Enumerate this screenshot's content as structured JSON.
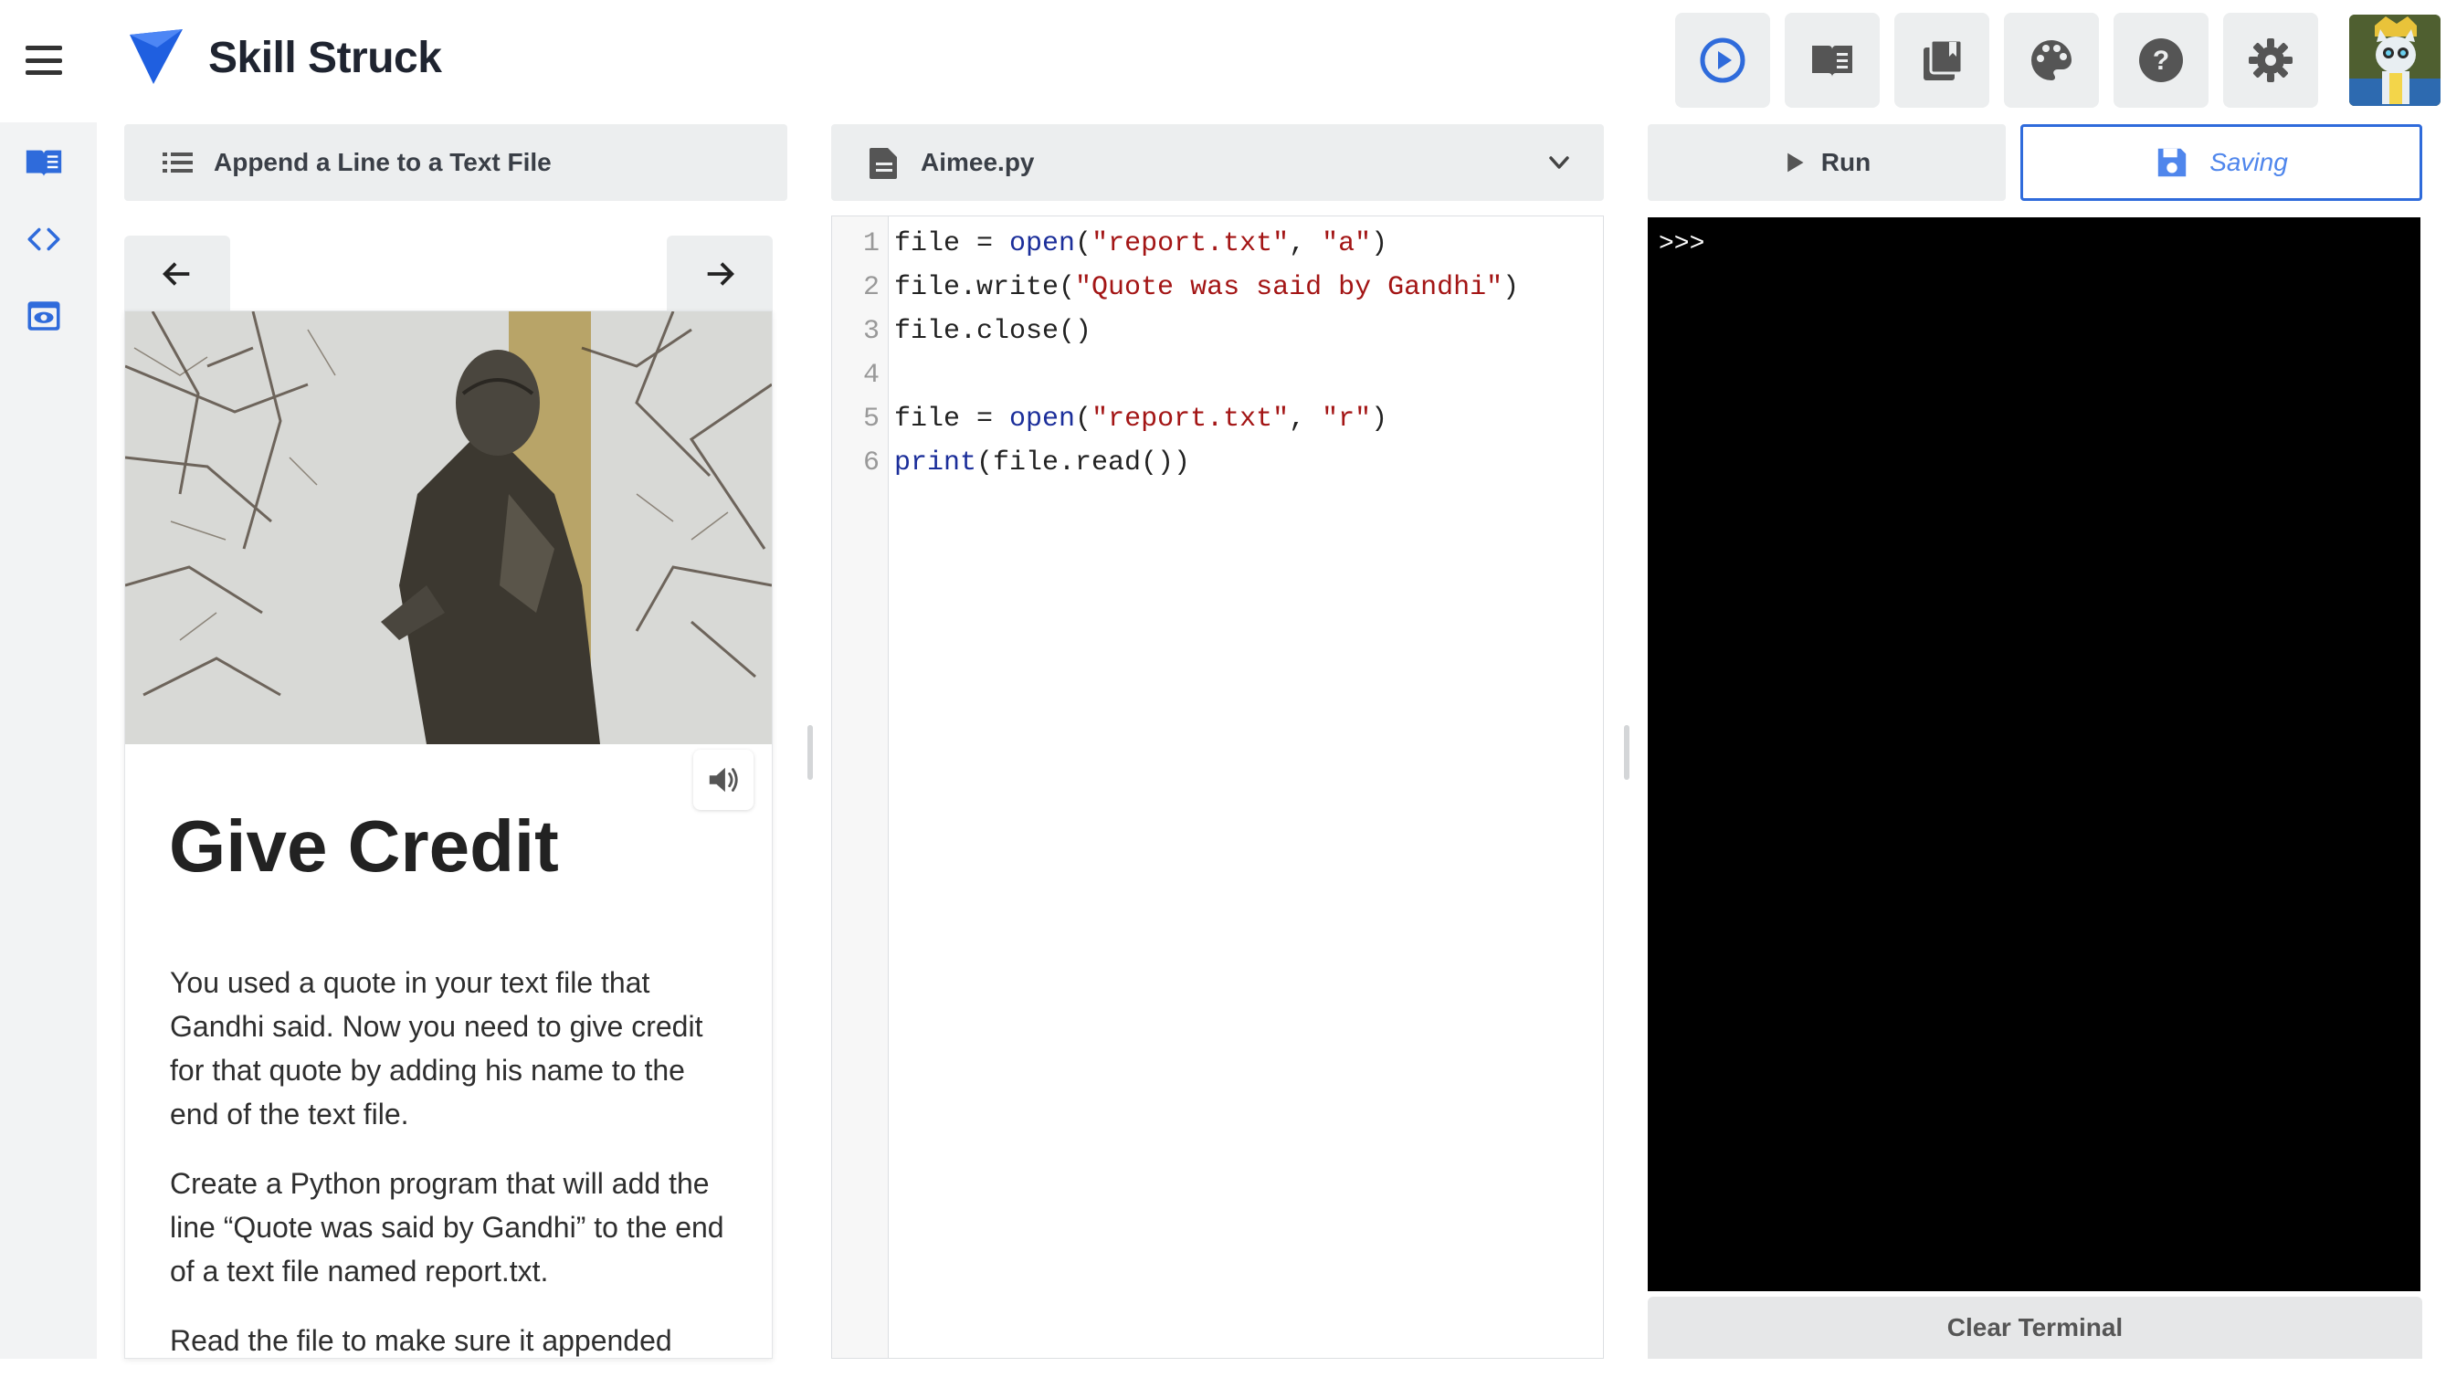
{
  "brand": {
    "name": "Skill Struck",
    "accent": "#1f5fe0"
  },
  "toolbar": {
    "icons": [
      "play-circle-icon",
      "book-open-icon",
      "library-icon",
      "palette-icon",
      "help-icon",
      "settings-icon"
    ]
  },
  "lesson": {
    "title": "Append a Line to a Text File",
    "card_title": "Give Credit",
    "paragraphs": [
      "You used a quote in your text file that Gandhi said. Now you need to give credit for that quote by adding his name to the end of the text file.",
      "Create a Python program that will add the line “Quote was said by Gandhi” to the end of a text file named report.txt.",
      "Read the file to make sure it appended"
    ]
  },
  "file": {
    "name": "Aimee.py"
  },
  "editor": {
    "line_numbers": [
      "1",
      "2",
      "3",
      "4",
      "5",
      "6"
    ],
    "lines": [
      [
        {
          "t": "file = ",
          "c": "n"
        },
        {
          "t": "open",
          "c": "k"
        },
        {
          "t": "(",
          "c": "n"
        },
        {
          "t": "\"report.txt\"",
          "c": "s"
        },
        {
          "t": ", ",
          "c": "n"
        },
        {
          "t": "\"a\"",
          "c": "s"
        },
        {
          "t": ")",
          "c": "n"
        }
      ],
      [
        {
          "t": "file.write(",
          "c": "n"
        },
        {
          "t": "\"Quote was said by Gandhi\"",
          "c": "s"
        },
        {
          "t": ")",
          "c": "n"
        }
      ],
      [
        {
          "t": "file.close()",
          "c": "n"
        }
      ],
      [],
      [
        {
          "t": "file = ",
          "c": "n"
        },
        {
          "t": "open",
          "c": "k"
        },
        {
          "t": "(",
          "c": "n"
        },
        {
          "t": "\"report.txt\"",
          "c": "s"
        },
        {
          "t": ", ",
          "c": "n"
        },
        {
          "t": "\"r\"",
          "c": "s"
        },
        {
          "t": ")",
          "c": "n"
        }
      ],
      [
        {
          "t": "print",
          "c": "k"
        },
        {
          "t": "(file.read())",
          "c": "n"
        }
      ]
    ]
  },
  "actions": {
    "run_label": "Run",
    "save_label": "Saving",
    "clear_label": "Clear Terminal"
  },
  "terminal": {
    "prompt": ">>>"
  }
}
